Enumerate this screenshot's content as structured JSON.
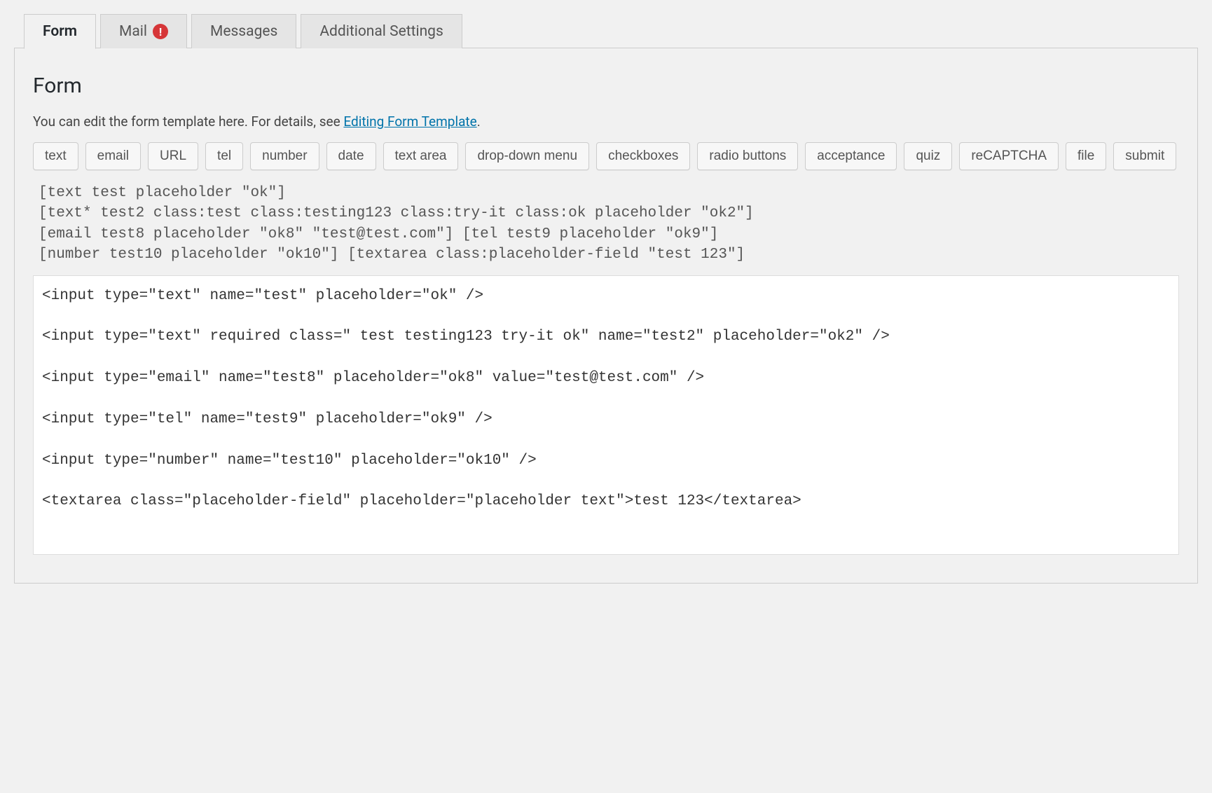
{
  "tabs": {
    "form": "Form",
    "mail": "Mail",
    "mail_alert": "!",
    "messages": "Messages",
    "additional": "Additional Settings"
  },
  "section": {
    "title": "Form",
    "intro_prefix": "You can edit the form template here. For details, see ",
    "intro_link": "Editing Form Template",
    "intro_suffix": "."
  },
  "tag_buttons": [
    "text",
    "email",
    "URL",
    "tel",
    "number",
    "date",
    "text area",
    "drop-down menu",
    "checkboxes",
    "radio buttons",
    "acceptance",
    "quiz",
    "reCAPTCHA",
    "file",
    "submit"
  ],
  "shortcode_text": "[text test placeholder \"ok\"]\n[text* test2 class:test class:testing123 class:try-it class:ok placeholder \"ok2\"]\n[email test8 placeholder \"ok8\" \"test@test.com\"] [tel test9 placeholder \"ok9\"]\n[number test10 placeholder \"ok10\"] [textarea class:placeholder-field \"test 123\"]",
  "html_output": "<input type=\"text\" name=\"test\" placeholder=\"ok\" />\n\n<input type=\"text\" required class=\" test testing123 try-it ok\" name=\"test2\" placeholder=\"ok2\" />\n\n<input type=\"email\" name=\"test8\" placeholder=\"ok8\" value=\"test@test.com\" />\n\n<input type=\"tel\" name=\"test9\" placeholder=\"ok9\" />\n\n<input type=\"number\" name=\"test10\" placeholder=\"ok10\" />\n\n<textarea class=\"placeholder-field\" placeholder=\"placeholder text\">test 123</textarea>"
}
